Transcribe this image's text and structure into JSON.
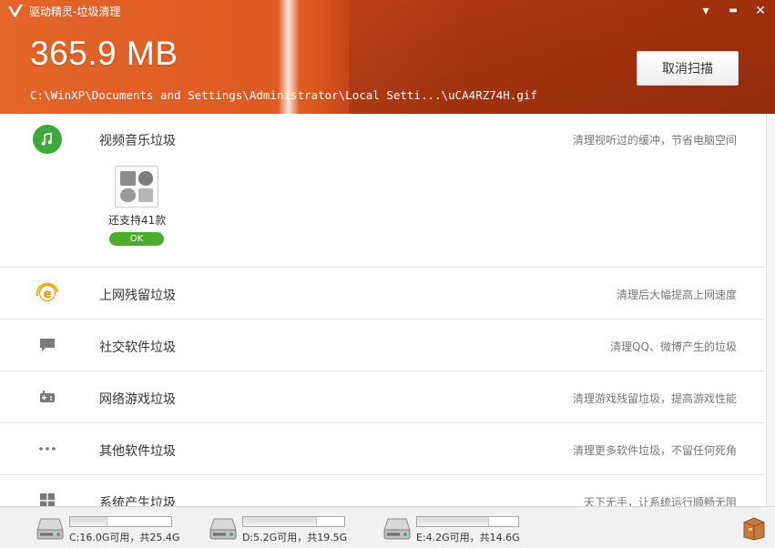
{
  "window": {
    "title": "驱动精灵-垃圾清理",
    "controls": {
      "menu": "▾",
      "minimize": "▬",
      "close": "✕"
    }
  },
  "header": {
    "size": "365.9 MB",
    "path": "C:\\WinXP\\Documents and Settings\\Administrator\\Local Setti...\\uCA4RZ74H.gif",
    "cancel_label": "取消扫描"
  },
  "categories": [
    {
      "title": "视频音乐垃圾",
      "desc": "清理视听过的缓冲，节省电脑空间",
      "icon": "music-icon"
    },
    {
      "title": "上网残留垃圾",
      "desc": "清理后大幅提高上网速度",
      "icon": "ie-icon"
    },
    {
      "title": "社交软件垃圾",
      "desc": "清理QQ、微博产生的垃圾",
      "icon": "chat-icon"
    },
    {
      "title": "网络游戏垃圾",
      "desc": "清理游戏残留垃圾，提高游戏性能",
      "icon": "gamepad-icon"
    },
    {
      "title": "其他软件垃圾",
      "desc": "清理更多软件垃圾，不留任何死角",
      "icon": "more-icon"
    },
    {
      "title": "系统产生垃圾",
      "desc": "天下无手，让系统运行顺畅无阻",
      "icon": "windows-icon"
    }
  ],
  "music_detail": {
    "support_text": "还支持41款",
    "status": "OK"
  },
  "drives": [
    {
      "text": "C:16.0G可用，共25.4G",
      "used_fraction": 0.37
    },
    {
      "text": "D:5.2G可用，共19.5G",
      "used_fraction": 0.73
    },
    {
      "text": "E:4.2G可用，共14.6G",
      "used_fraction": 0.71
    }
  ],
  "colors": {
    "header_accent": "#dd5a22",
    "ok_green": "#4dab2e",
    "music_green": "#3ea83a"
  }
}
